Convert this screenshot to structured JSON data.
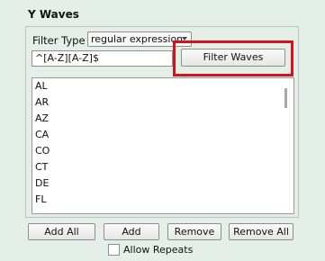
{
  "panel": {
    "title": "Y Waves"
  },
  "filter": {
    "type_label": "Filter Type",
    "type_value": "regular expression",
    "regex_value": "^[A-Z][A-Z]$",
    "filter_button": "Filter Waves"
  },
  "list": {
    "items": [
      "AL",
      "AR",
      "AZ",
      "CA",
      "CO",
      "CT",
      "DE",
      "FL"
    ]
  },
  "buttons": {
    "add_all": "Add All",
    "add": "Add",
    "remove": "Remove",
    "remove_all": "Remove All"
  },
  "allow_repeats": {
    "label": "Allow Repeats",
    "checked": false
  },
  "colors": {
    "highlight": "#d4141c",
    "background": "#e4efe8"
  }
}
